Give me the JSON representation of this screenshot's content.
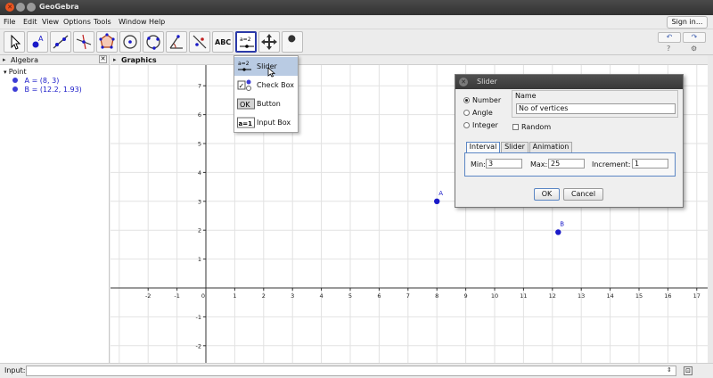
{
  "window": {
    "title": "GeoGebra"
  },
  "menu": [
    "File",
    "Edit",
    "View",
    "Options",
    "Tools",
    "Window",
    "Help"
  ],
  "signin_label": "Sign in...",
  "toolbar": {
    "tools": [
      "move",
      "point",
      "line",
      "perpendicular-line",
      "polygon",
      "circle",
      "circle-through-points",
      "angle",
      "reflect",
      "text",
      "slider",
      "move-graphics-view",
      "properties"
    ],
    "text_tool_label": "ABC",
    "slider_tool_label": "a=2",
    "undo_icon": "↶",
    "redo_icon": "↷",
    "help_label": "?",
    "settings_icon": "⚙"
  },
  "algebra": {
    "header": "Algebra",
    "category": "Point",
    "items": [
      {
        "label": "A = (8, 3)",
        "color": "#3d3dd6"
      },
      {
        "label": "B = (12.2, 1.93)",
        "color": "#3d3dd6"
      }
    ]
  },
  "graphics": {
    "header": "Graphics",
    "x_ticks": [
      "-2",
      "-1",
      "0",
      "1",
      "2",
      "3",
      "4",
      "5",
      "6",
      "7",
      "8",
      "9",
      "10",
      "11",
      "12",
      "13",
      "14",
      "15",
      "16",
      "17"
    ],
    "y_ticks": [
      "7",
      "6",
      "5",
      "4",
      "3",
      "2",
      "1",
      "-1",
      "-2"
    ],
    "points": [
      {
        "name": "A",
        "x": 8,
        "y": 3
      },
      {
        "name": "B",
        "x": 12.2,
        "y": 1.93
      }
    ],
    "point_color": "#1a1ac8"
  },
  "dropdown": {
    "items": [
      {
        "label": "Slider",
        "icon": "a=2"
      },
      {
        "label": "Check Box",
        "icon": "✓"
      },
      {
        "label": "Button",
        "icon": "OK"
      },
      {
        "label": "Input Box",
        "icon": "a=1"
      }
    ]
  },
  "dialog": {
    "title": "Slider",
    "radios": [
      "Number",
      "Angle",
      "Integer"
    ],
    "selected_radio": "Number",
    "name_label": "Name",
    "name_value": "No of vertices",
    "random_label": "Random",
    "tabs": [
      "Interval",
      "Slider",
      "Animation"
    ],
    "min_label": "Min:",
    "min_value": "3",
    "max_label": "Max:",
    "max_value": "25",
    "increment_label": "Increment:",
    "increment_value": "1",
    "ok_label": "OK",
    "cancel_label": "Cancel"
  },
  "input": {
    "label": "Input:",
    "value": "",
    "dropdown_icon": "⇕",
    "keyboard_icon": "⊡"
  }
}
